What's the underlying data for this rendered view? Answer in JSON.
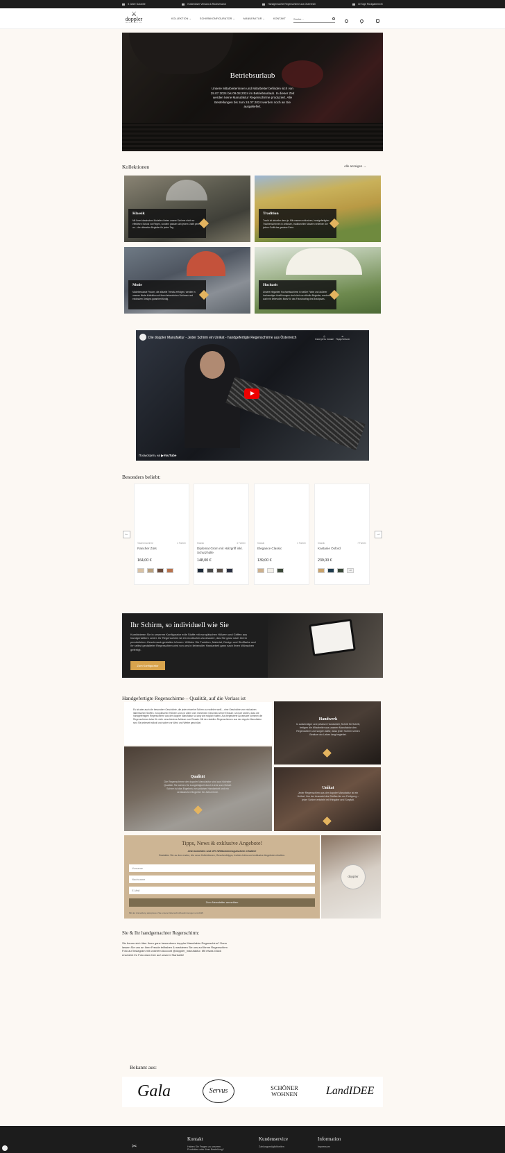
{
  "topbar": {
    "items": [
      "5 Jahre Garantie",
      "Kostenloser Versand & Rückversand",
      "Handgemachte Regenschirme aus Österreich",
      "30 Tage Rückgaberecht"
    ]
  },
  "header": {
    "logo_word": "doppler",
    "logo_sub": "MANUFAKTUR",
    "nav": [
      "KOLLEKTION ⌄",
      "SCHIRMKONFIGURATOR ⌄",
      "MANUFAKTUR ⌄",
      "KONTAKT"
    ],
    "search_placeholder": "Suche..."
  },
  "hero": {
    "title": "Betriebsurlaub",
    "text": "Unsere Mitarbeiterinnen und Mitarbeiter befinden sich von 29.07.2024 bis 09.08.2024 im Betriebsurlaub. In dieser Zeit werden keine Manufaktur Regenschirme produziert. Alle Bestellungen bis zum 24.07.2024 werden noch an Sie ausgeliefert."
  },
  "collections": {
    "heading": "Kollektionen",
    "all_link": "Alle anzeigen",
    "items": [
      {
        "title": "Klassik",
        "text": "Mit Ihren klassischen Modellen bieten unsere Schirme nicht nur effektiven Schutz vor Regen, sondern passen sich jedem Outfit perfekt an – der ultimative Begleiter für jeden Tag."
      },
      {
        "title": "Tradition",
        "text": "Tracht ist aktueller denn je. Mit unseren exklusiven, handgefertigten Trachtenschirmen in zeitlosen, traditionellen Mustern verleihen Sie jedem Outfit das gewisse Extra."
      },
      {
        "title": "Mode",
        "text": "Modebewusste Frauen, die aktuelle Trends verfolgen, werden in unserer Mode-Kollektion mit ihren farbenfrohen Schirmen und exklusiven Designs garantiert fündig."
      },
      {
        "title": "Hochzeit",
        "text": "Unsere eleganten Hochzeitsschirme in weißer Farbe und äußerer hochwertiger Ausführungen sind nicht nur stilvolle Begleiter, sondern auch ein liebevolles Motiv für das Fotoshooting des Brautpaars."
      }
    ]
  },
  "video": {
    "title": "Die doppler Manufaktur - Jeder Schirm ein Unikat - handgefertigte Regenschirme aus Österreich",
    "later": "Смотреть позже",
    "share": "Поделиться",
    "watch_on": "Посмотреть на",
    "brand": "YouTube"
  },
  "products": {
    "heading": "Besonders beliebt:",
    "items": [
      {
        "category": "Taschenschirme",
        "colors": "4 Farben",
        "name": "Rancher Zürs",
        "price": "164,00 €",
        "swatches": [
          "#d9c2a4",
          "#b9a07f",
          "#6b4a3a",
          "#b8734f"
        ]
      },
      {
        "category": "Klassik",
        "colors": "4 Farben",
        "name": "Diplomat Grom mit Holzgriff inkl. Schutzhülle",
        "price": "148,00 €",
        "swatches": [
          "#1e2a38",
          "#4a4a4a",
          "#5a5048",
          "#2b3142"
        ]
      },
      {
        "category": "Klassik",
        "colors": "3 Farben",
        "name": "Elegance Classic",
        "price": "139,00 €",
        "swatches": [
          "#cdb18e",
          "#f2efe8",
          "#3d4a3a"
        ]
      },
      {
        "category": "Klassik",
        "colors": "7 Farben",
        "name": "Kastanie Oxford",
        "price": "239,00 €",
        "swatches": [
          "#c9a36c",
          "#1f3b4d",
          "#3b4a3a",
          "#e0e0e0"
        ]
      }
    ],
    "extra_swatch_label": "+3"
  },
  "konfigurator": {
    "title": "Ihr Schirm, so individuell wie Sie",
    "text": "Kombinieren Sie in unserem Konfigurator edle Stoffe mit europäischen Hölzern und Griffen aus handgenähtem Leder. Ihr Regenschirm ist ein modisches Accessoire, das Sie ganz nach Ihrem persönlichen Geschmack gestalten können. Wählen Sie Funktion, Material, Design und Stofffarbe und Ihr selbst gestalteter Regenschirm wird von uns in liebevoller Handarbeit ganz nach Ihren Wünschen gefertigt.",
    "button": "Zum Konfigurator"
  },
  "quality": {
    "heading": "Handgefertigte Regenschirme – Qualität, auf die Verlass ist",
    "intro": "Es ist aber auch die besondere Geschichte, die jeder einzelne Schirm zu erzählen weiß – eine Geschichte von exklusiven italienischen Stoffen, europäischen Hölzern und vor allem vom immensen Geschick seiner Erbauer. Und wir wollen, dass die handgefertigten Regenschirme aus der doppler Manufaktur so lang wie möglich halten. Aus begeisterte Accessoire kommen die Regenschirme daher für viele verschiedene Anlässe zum Einsatz. Mit den stabilen Regenschirmen aus der doppler Manufaktur sind Sie jederzeit stilvoll und sicher vor Wind und Wetter geschützt.",
    "tiles": [
      {
        "title": "Handwerk",
        "text": "In aufwendiger und präziser Handarbeit, Schritt für Schritt, fertigen die Mitarbeiter aus unserer Manufaktur den Regenschirm und sorgen dafür, dass jeder Schirm seinen Besitzer ein Leben lang begleitet."
      },
      {
        "title": "Qualität",
        "text": "Die Regenschirme der doppler Manufaktur sind aus höchster Qualität. Sie stehen für Langlebigkeit durch Liebe zum Detail. Schirm ist das Ergebnis von präziser Handarbeit und ein verlässlicher Begleiter für Jahrzehnte."
      },
      {
        "title": "Unikat",
        "text": "Jeder Regenschirm aus der doppler Manufaktur ist ein Unikat. Von der Auswahl des Stoffes bis zur Fertigung – jeder Schirm entsteht mit Hingabe und Sorgfalt."
      }
    ]
  },
  "newsletter": {
    "title": "Tipps, News & exklusive Angebote!",
    "line1": "Jetzt anmelden und 10% Willkommensgutschein erhalten!",
    "line2": "Gestalten Sie zu den ersten, die neue Kollektionen, Geschenktipps, Insider-Infos und exklusive Angebote erhalten.",
    "firstname": "Vorname",
    "lastname": "Nachname",
    "email": "E-Mail",
    "button": "Zum Newsletter anmelden",
    "disclaimer": "Mit der Anmeldung akzeptieren Sie unsere Datenschutzbestimmungen und AGB."
  },
  "social": {
    "heading": "Sie & Ihr handgemachter Regenschirm:",
    "text": "Sie freuen sich über Ihren ganz besonderen doppler Manufaktur Regenschirm? Dann lassen Sie uns an Ihrer Freude teilhaben & markieren Sie uns auf Ihrem Regenschirm Foto auf Instagram mit unserem Account @doppler_manufaktur. Mit etwas Glück erscheint Ihr Foto dann hier auf unserer Startseite!"
  },
  "press": {
    "heading": "Bekannt aus:",
    "logos": [
      "Gala",
      "Servus",
      "SCHÖNER WOHNEN",
      "LandIDEE"
    ]
  },
  "footer": {
    "cols": [
      {
        "title": "Kontakt",
        "line": "Haben Sie Fragen zu unseren Produkten oder Ihrer Bestellung?"
      },
      {
        "title": "Kundenservice",
        "line": "Zahlungsmöglichkeiten"
      },
      {
        "title": "Information",
        "line": "Impressum"
      }
    ]
  }
}
